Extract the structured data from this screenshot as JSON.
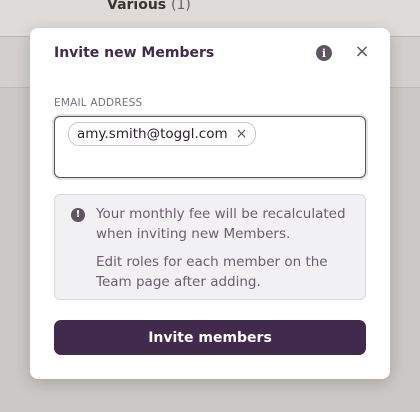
{
  "background": {
    "top_label": "Various",
    "top_count": "(1)"
  },
  "modal": {
    "title": "Invite new Members",
    "info_icon": "i",
    "close_icon": "×",
    "email_label": "EMAIL ADDRESS",
    "emails": [
      "amy.smith@toggl.com"
    ],
    "chip_remove_icon": "×",
    "notice_icon": "!",
    "notice_line1": "Your monthly fee will be recalculated when inviting new Members.",
    "notice_line2": "Edit roles for each member on the Team page after adding.",
    "submit_label": "Invite members"
  },
  "colors": {
    "primary": "#412a4c",
    "overlay": "#cbc8c5"
  }
}
